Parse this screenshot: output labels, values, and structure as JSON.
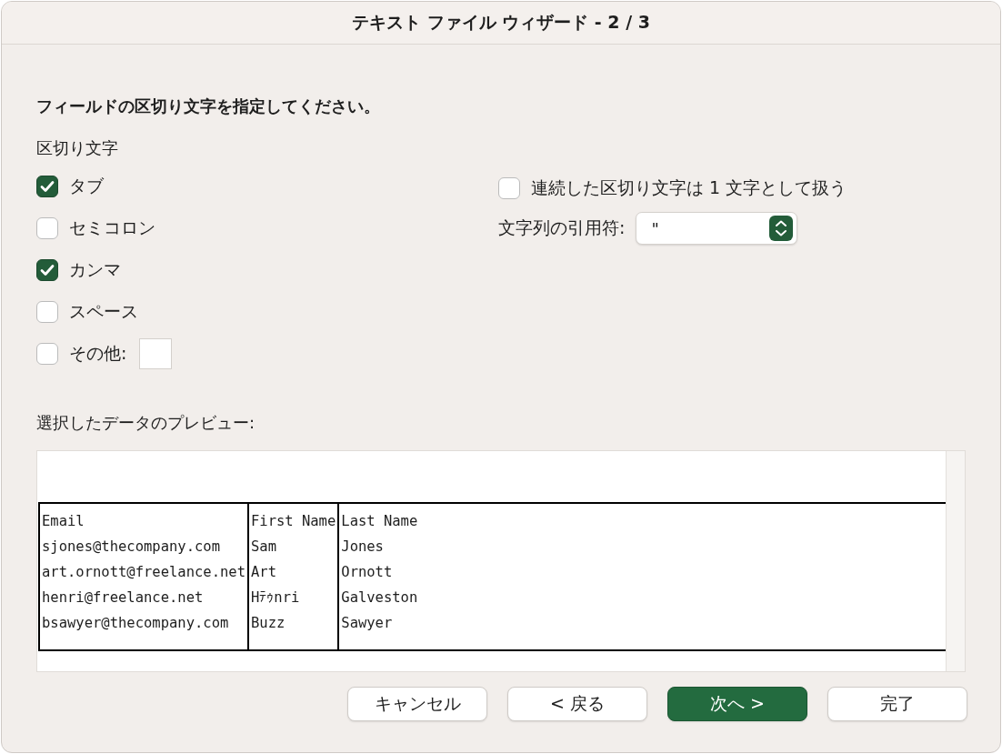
{
  "window": {
    "title": "テキスト ファイル ウィザード - 2 / 3"
  },
  "instruction": "フィールドの区切り文字を指定してください。",
  "delimiters": {
    "heading": "区切り文字",
    "items": [
      {
        "label": "タブ",
        "checked": true,
        "kind": "checkbox"
      },
      {
        "label": "セミコロン",
        "checked": false,
        "kind": "checkbox"
      },
      {
        "label": "カンマ",
        "checked": true,
        "kind": "checkbox"
      },
      {
        "label": "スペース",
        "checked": false,
        "kind": "checkbox"
      },
      {
        "label": "その他:",
        "checked": false,
        "kind": "other"
      }
    ]
  },
  "options": {
    "consecutive": {
      "label": "連続した区切り文字は 1 文字として扱う",
      "checked": false
    },
    "qualifier": {
      "label": "文字列の引用符:",
      "value": "\""
    }
  },
  "preview": {
    "heading": "選択したデータのプレビュー:",
    "columns": [
      [
        "Email",
        "sjones@thecompany.com",
        "art.ornott@freelance.net",
        "henri@freelance.net",
        "bsawyer@thecompany.com"
      ],
      [
        "First Name",
        "Sam",
        "Art",
        "Hﾃｩnri",
        "Buzz"
      ],
      [
        "Last Name",
        "Jones",
        "Ornott",
        "Galveston",
        "Sawyer"
      ]
    ]
  },
  "buttons": [
    {
      "label": "キャンセル",
      "kind": "normal"
    },
    {
      "label": "< 戻る",
      "kind": "normal"
    },
    {
      "label": "次へ >",
      "kind": "primary"
    },
    {
      "label": "完了",
      "kind": "normal"
    }
  ]
}
